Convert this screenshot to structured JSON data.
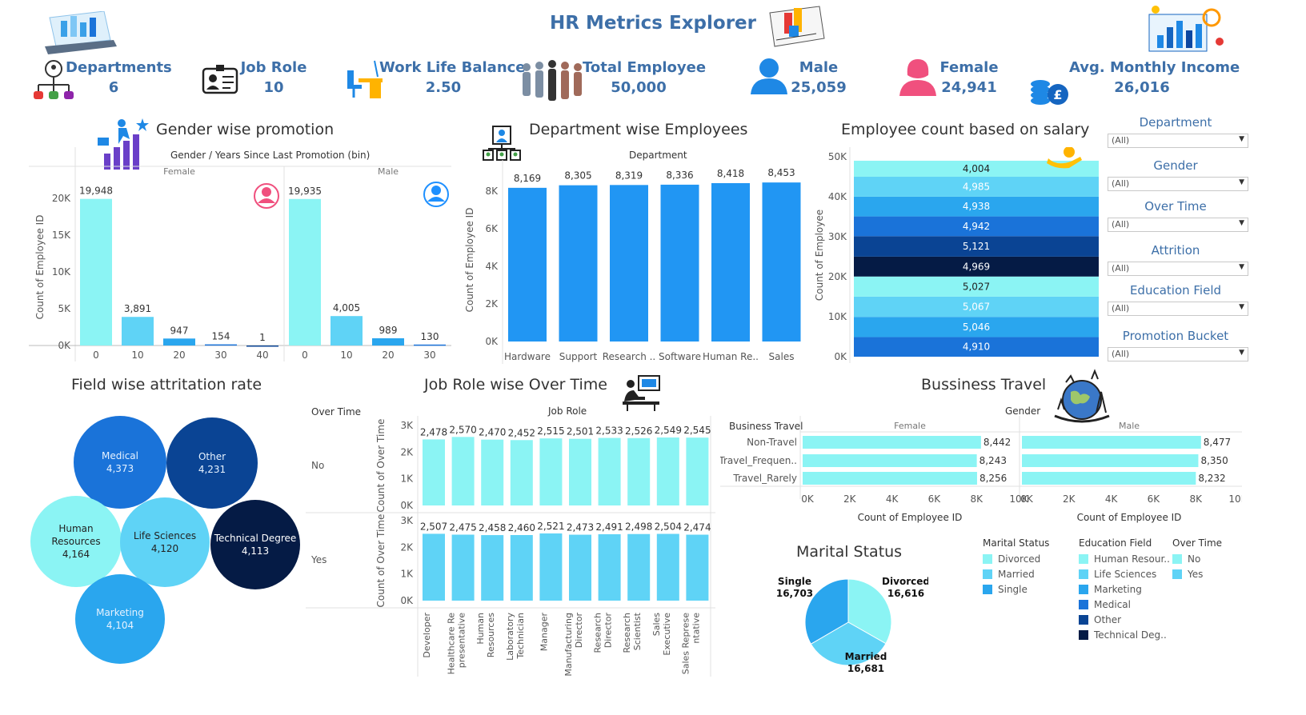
{
  "title": "HR Metrics Explorer",
  "colors": {
    "accent": "#3d6fa8",
    "c1": "#8bf4f4",
    "c2": "#5fd3f6",
    "c3": "#2aa6ee",
    "c4": "#1a73d9",
    "c5": "#0a4494",
    "c6": "#051b45",
    "female": "#f0507e",
    "male": "#1e90ff"
  },
  "kpis": [
    {
      "label": "Departments",
      "value": "6",
      "icon": "org-chart-icon"
    },
    {
      "label": "Job Role",
      "value": "10",
      "icon": "id-card-icon"
    },
    {
      "label": "Work Life Balance",
      "value": "2.50",
      "icon": "office-desk-icon"
    },
    {
      "label": "Total Employee",
      "value": "50,000",
      "icon": "crowd-icon"
    },
    {
      "label": "Male",
      "value": "25,059",
      "icon": "male-user-icon"
    },
    {
      "label": "Female",
      "value": "24,941",
      "icon": "female-user-icon"
    },
    {
      "label": "Avg. Monthly Income",
      "value": "26,016",
      "icon": "coins-icon"
    }
  ],
  "filters": [
    {
      "label": "Department",
      "value": "(All)"
    },
    {
      "label": "Gender",
      "value": "(All)"
    },
    {
      "label": "Over Time",
      "value": "(All)"
    },
    {
      "label": "Attrition",
      "value": "(All)"
    },
    {
      "label": "Education Field",
      "value": "(All)"
    },
    {
      "label": "Promotion Bucket",
      "value": "(All)"
    }
  ],
  "promotion": {
    "title": "Gender wise promotion",
    "header": "Gender  /  Years Since Last Promotion (bin)",
    "ylabel": "Count of Employee ID",
    "yticks": [
      "20K",
      "15K",
      "10K",
      "5K",
      "0K"
    ],
    "panels": [
      {
        "name": "Female",
        "bins": [
          "0",
          "10",
          "20",
          "30",
          "40"
        ]
      },
      {
        "name": "Male",
        "bins": [
          "0",
          "10",
          "20",
          "30"
        ]
      }
    ]
  },
  "department": {
    "title": "Department wise Employees",
    "header": "Department",
    "ylabel": "Count of Employee ID",
    "yticks": [
      "8K",
      "6K",
      "4K",
      "2K",
      "0K"
    ]
  },
  "salary": {
    "title": "Employee count based on salary",
    "ylabel": "Count of Employee",
    "yticks": [
      "50K",
      "40K",
      "30K",
      "20K",
      "10K",
      "0K"
    ]
  },
  "attrition": {
    "title": "Field wise attritation rate",
    "bubbles": [
      {
        "name": "Medical",
        "value": "4,373"
      },
      {
        "name": "Other",
        "value": "4,231"
      },
      {
        "name": "Human Resources",
        "value": "4,164"
      },
      {
        "name": "Life Sciences",
        "value": "4,120"
      },
      {
        "name": "Technical Degree",
        "value": "4,113"
      },
      {
        "name": "Marketing",
        "value": "4,104"
      }
    ]
  },
  "jobrole": {
    "title": "Job Role wise Over Time",
    "row_header": "Over Time",
    "col_header": "Job Role",
    "ylabel": "Count of Over Time",
    "rows": [
      "No",
      "Yes"
    ],
    "yticks": [
      "3K",
      "2K",
      "1K",
      "0K"
    ],
    "roles": [
      "Developer",
      "Healthcare Re presentative",
      "Human Resources",
      "Laboratory Technician",
      "Manager",
      "Manufacturing Director",
      "Research Director",
      "Research Scientist",
      "Sales Executive",
      "Sales Represe ntative"
    ]
  },
  "travel": {
    "title": "Bussiness Travel",
    "row_header": "Business Travel",
    "col_header": "Gender",
    "panels": [
      "Female",
      "Male"
    ],
    "categories": [
      "Non-Travel",
      "Travel_Frequen..",
      "Travel_Rarely"
    ],
    "xticks": [
      "0K",
      "2K",
      "4K",
      "6K",
      "8K",
      "10K"
    ],
    "xlabel": "Count of Employee ID"
  },
  "marital": {
    "title": "Marital Status",
    "slices": [
      {
        "name": "Divorced",
        "value": "16,616"
      },
      {
        "name": "Married",
        "value": "16,681"
      },
      {
        "name": "Single",
        "value": "16,703"
      }
    ]
  },
  "legends": [
    {
      "title": "Marital Status",
      "items": [
        "Divorced",
        "Married",
        "Single"
      ]
    },
    {
      "title": "Education Field",
      "items": [
        "Human Resour..",
        "Life Sciences",
        "Marketing",
        "Medical",
        "Other",
        "Technical Deg.."
      ]
    },
    {
      "title": "Over Time",
      "items": [
        "No",
        "Yes"
      ]
    }
  ],
  "chart_data": [
    {
      "type": "bar",
      "title": "Gender wise promotion",
      "xlabel": "Years Since Last Promotion (bin)",
      "ylabel": "Count of Employee ID",
      "ylim": [
        0,
        21000
      ],
      "panels": [
        {
          "name": "Female",
          "categories": [
            "0",
            "10",
            "20",
            "30",
            "40"
          ],
          "values": [
            19948,
            3891,
            947,
            154,
            1
          ],
          "labels": [
            "19,948",
            "3,891",
            "947",
            "154",
            "1"
          ]
        },
        {
          "name": "Male",
          "categories": [
            "0",
            "10",
            "20",
            "30"
          ],
          "values": [
            19935,
            4005,
            989,
            130
          ],
          "labels": [
            "19,935",
            "4,005",
            "989",
            "130"
          ]
        }
      ]
    },
    {
      "type": "bar",
      "title": "Department wise Employees",
      "xlabel": "Department",
      "ylabel": "Count of Employee ID",
      "ylim": [
        0,
        8800
      ],
      "categories": [
        "Hardware",
        "Support",
        "Research ..",
        "Software",
        "Human Re..",
        "Sales"
      ],
      "values": [
        8169,
        8305,
        8319,
        8336,
        8418,
        8453
      ],
      "labels": [
        "8,169",
        "8,305",
        "8,319",
        "8,336",
        "8,418",
        "8,453"
      ]
    },
    {
      "type": "bar",
      "title": "Employee count based on salary",
      "ylabel": "Count of Employee",
      "ylim": [
        0,
        52000
      ],
      "segments": [
        4910,
        5046,
        5067,
        5027,
        4969,
        5121,
        4942,
        4938,
        4985,
        4004
      ],
      "labels": [
        "4,910",
        "5,046",
        "5,067",
        "5,027",
        "4,969",
        "5,121",
        "4,942",
        "4,938",
        "4,985",
        "4,004"
      ]
    },
    {
      "type": "bar",
      "title": "Job Role wise Over Time",
      "ylabel": "Count of Over Time",
      "ylim": [
        0,
        3000
      ],
      "series": [
        {
          "name": "No",
          "values": [
            2478,
            2570,
            2470,
            2452,
            2515,
            2501,
            2533,
            2526,
            2549,
            2545
          ],
          "labels": [
            "2,478",
            "2,570",
            "2,470",
            "2,452",
            "2,515",
            "2,501",
            "2,533",
            "2,526",
            "2,549",
            "2,545"
          ]
        },
        {
          "name": "Yes",
          "values": [
            2507,
            2475,
            2458,
            2460,
            2521,
            2473,
            2491,
            2498,
            2504,
            2474
          ],
          "labels": [
            "2,507",
            "2,475",
            "2,458",
            "2,460",
            "2,521",
            "2,473",
            "2,491",
            "2,498",
            "2,504",
            "2,474"
          ]
        }
      ]
    },
    {
      "type": "bar",
      "title": "Bussiness Travel",
      "xlabel": "Count of Employee ID",
      "xlim": [
        0,
        10000
      ],
      "categories": [
        "Non-Travel",
        "Travel_Frequen..",
        "Travel_Rarely"
      ],
      "series": [
        {
          "name": "Female",
          "values": [
            8442,
            8243,
            8256
          ],
          "labels": [
            "8,442",
            "8,243",
            "8,256"
          ]
        },
        {
          "name": "Male",
          "values": [
            8477,
            8350,
            8232
          ],
          "labels": [
            "8,477",
            "8,350",
            "8,232"
          ]
        }
      ]
    },
    {
      "type": "pie",
      "title": "Marital Status",
      "categories": [
        "Divorced",
        "Married",
        "Single"
      ],
      "values": [
        16616,
        16681,
        16703
      ]
    }
  ]
}
